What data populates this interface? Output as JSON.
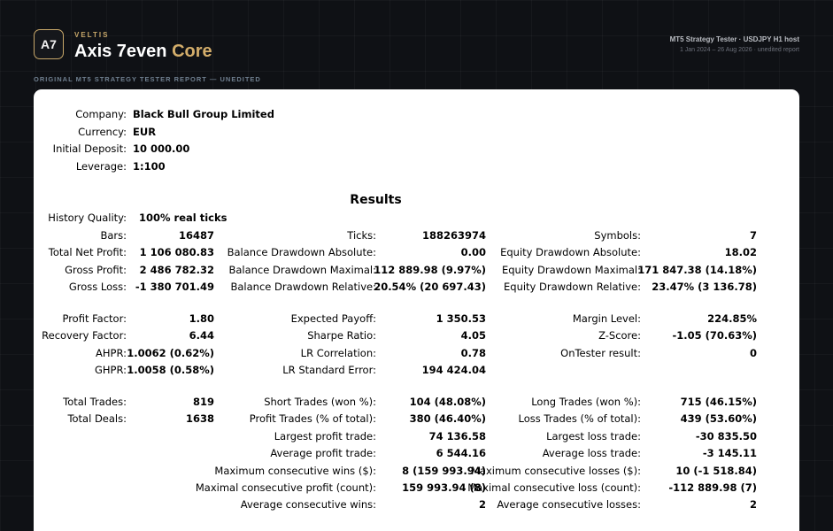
{
  "header": {
    "logo": "A7",
    "brand_small": "VELTIS",
    "title_main": "Axis 7even",
    "title_accent": "Core",
    "right_line1": "MT5 Strategy Tester · USDJPY H1 host",
    "right_line2": "1 Jan 2024 – 26 Aug 2026 · unedited report"
  },
  "subtitle": "ORIGINAL MT5 STRATEGY TESTER REPORT — UNEDITED",
  "info": [
    {
      "label": "Company:",
      "value": "Black Bull Group Limited"
    },
    {
      "label": "Currency:",
      "value": "EUR"
    },
    {
      "label": "Initial Deposit:",
      "value": "10 000.00"
    },
    {
      "label": "Leverage:",
      "value": "1:100"
    }
  ],
  "results_title": "Results",
  "history_quality": {
    "label": "History Quality:",
    "value": "100% real ticks"
  },
  "rows": [
    [
      {
        "label": "Bars:",
        "value": "16487"
      },
      {
        "label": "Ticks:",
        "value": "188263974"
      },
      {
        "label": "Symbols:",
        "value": "7"
      }
    ],
    [
      {
        "label": "Total Net Profit:",
        "value": "1 106 080.83"
      },
      {
        "label": "Balance Drawdown Absolute:",
        "value": "0.00"
      },
      {
        "label": "Equity Drawdown Absolute:",
        "value": "18.02"
      }
    ],
    [
      {
        "label": "Gross Profit:",
        "value": "2 486 782.32"
      },
      {
        "label": "Balance Drawdown Maximal:",
        "value": "112 889.98 (9.97%)"
      },
      {
        "label": "Equity Drawdown Maximal:",
        "value": "171 847.38 (14.18%)"
      }
    ],
    [
      {
        "label": "Gross Loss:",
        "value": "-1 380 701.49"
      },
      {
        "label": "Balance Drawdown Relative:",
        "value": "20.54% (20 697.43)"
      },
      {
        "label": "Equity Drawdown Relative:",
        "value": "23.47% (3 136.78)"
      }
    ],
    null,
    [
      {
        "label": "Profit Factor:",
        "value": "1.80"
      },
      {
        "label": "Expected Payoff:",
        "value": "1 350.53"
      },
      {
        "label": "Margin Level:",
        "value": "224.85%"
      }
    ],
    [
      {
        "label": "Recovery Factor:",
        "value": "6.44"
      },
      {
        "label": "Sharpe Ratio:",
        "value": "4.05"
      },
      {
        "label": "Z-Score:",
        "value": "-1.05 (70.63%)"
      }
    ],
    [
      {
        "label": "AHPR:",
        "value": "1.0062 (0.62%)"
      },
      {
        "label": "LR Correlation:",
        "value": "0.78"
      },
      {
        "label": "OnTester result:",
        "value": "0"
      }
    ],
    [
      {
        "label": "GHPR:",
        "value": "1.0058 (0.58%)"
      },
      {
        "label": "LR Standard Error:",
        "value": "194 424.04"
      },
      null
    ],
    null,
    [
      {
        "label": "Total Trades:",
        "value": "819"
      },
      {
        "label": "Short Trades (won %):",
        "value": "104 (48.08%)"
      },
      {
        "label": "Long Trades (won %):",
        "value": "715 (46.15%)"
      }
    ],
    [
      {
        "label": "Total Deals:",
        "value": "1638"
      },
      {
        "label": "Profit Trades (% of total):",
        "value": "380 (46.40%)"
      },
      {
        "label": "Loss Trades (% of total):",
        "value": "439 (53.60%)"
      }
    ],
    [
      null,
      {
        "label": "Largest profit trade:",
        "value": "74 136.58"
      },
      {
        "label": "Largest loss trade:",
        "value": "-30 835.50"
      }
    ],
    [
      null,
      {
        "label": "Average profit trade:",
        "value": "6 544.16"
      },
      {
        "label": "Average loss trade:",
        "value": "-3 145.11"
      }
    ],
    [
      null,
      {
        "label": "Maximum consecutive wins ($):",
        "value": "8 (159 993.94)"
      },
      {
        "label": "Maximum consecutive losses ($):",
        "value": "10 (-1 518.84)"
      }
    ],
    [
      null,
      {
        "label": "Maximal consecutive profit (count):",
        "value": "159 993.94 (8)"
      },
      {
        "label": "Maximal consecutive loss (count):",
        "value": "-112 889.98 (7)"
      }
    ],
    [
      null,
      {
        "label": "Average consecutive wins:",
        "value": "2"
      },
      {
        "label": "Average consecutive losses:",
        "value": "2"
      }
    ]
  ]
}
